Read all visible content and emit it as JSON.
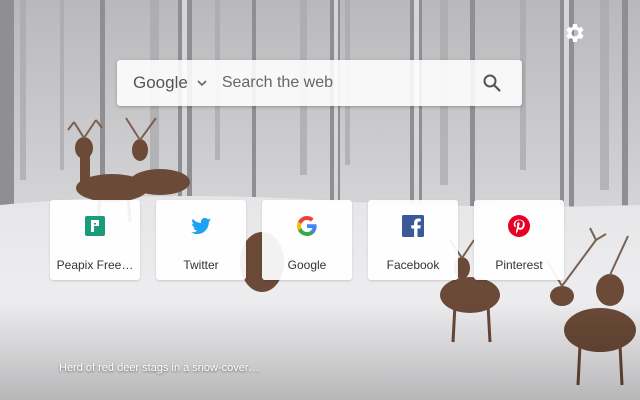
{
  "search": {
    "engine": "Google",
    "placeholder": "Search the web",
    "value": ""
  },
  "shortcuts": [
    {
      "label": "Peapix Free…",
      "icon": "peapix-icon",
      "color": "#1a9b7b"
    },
    {
      "label": "Twitter",
      "icon": "twitter-icon",
      "color": "#1da1f2"
    },
    {
      "label": "Google",
      "icon": "google-icon",
      "color": "#4285f4"
    },
    {
      "label": "Facebook",
      "icon": "facebook-icon",
      "color": "#3b5998"
    },
    {
      "label": "Pinterest",
      "icon": "pinterest-icon",
      "color": "#e60023"
    }
  ],
  "caption": "Herd of red deer stags in a snow-cover…",
  "settings_icon": "gear-icon"
}
